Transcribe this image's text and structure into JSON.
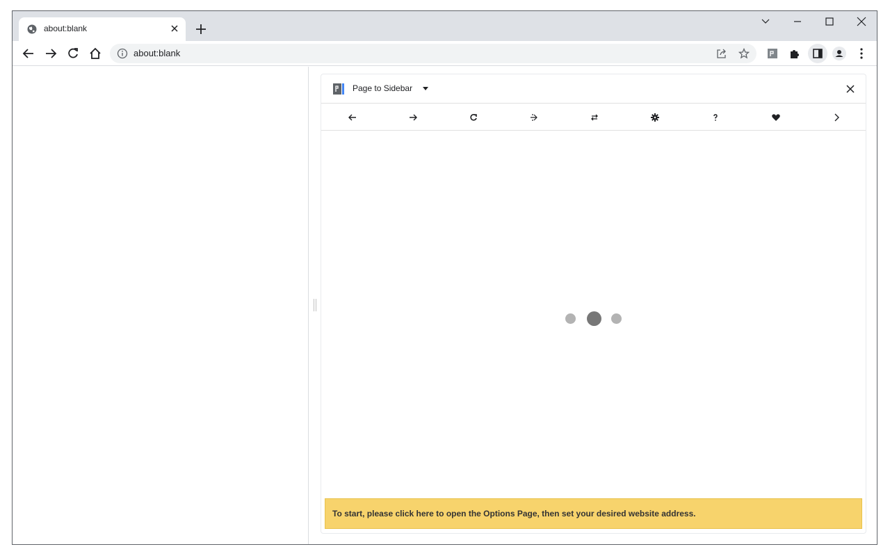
{
  "tab": {
    "title": "about:blank"
  },
  "omnibox": {
    "url": "about:blank"
  },
  "sidepanel": {
    "title": "Page to Sidebar",
    "banner_text": "To start, please click here to open the Options Page, then set your desired website address."
  },
  "colors": {
    "banner_bg": "#f7d36c",
    "titlebar_bg": "#dee1e6",
    "omnibox_bg": "#f1f3f4"
  }
}
